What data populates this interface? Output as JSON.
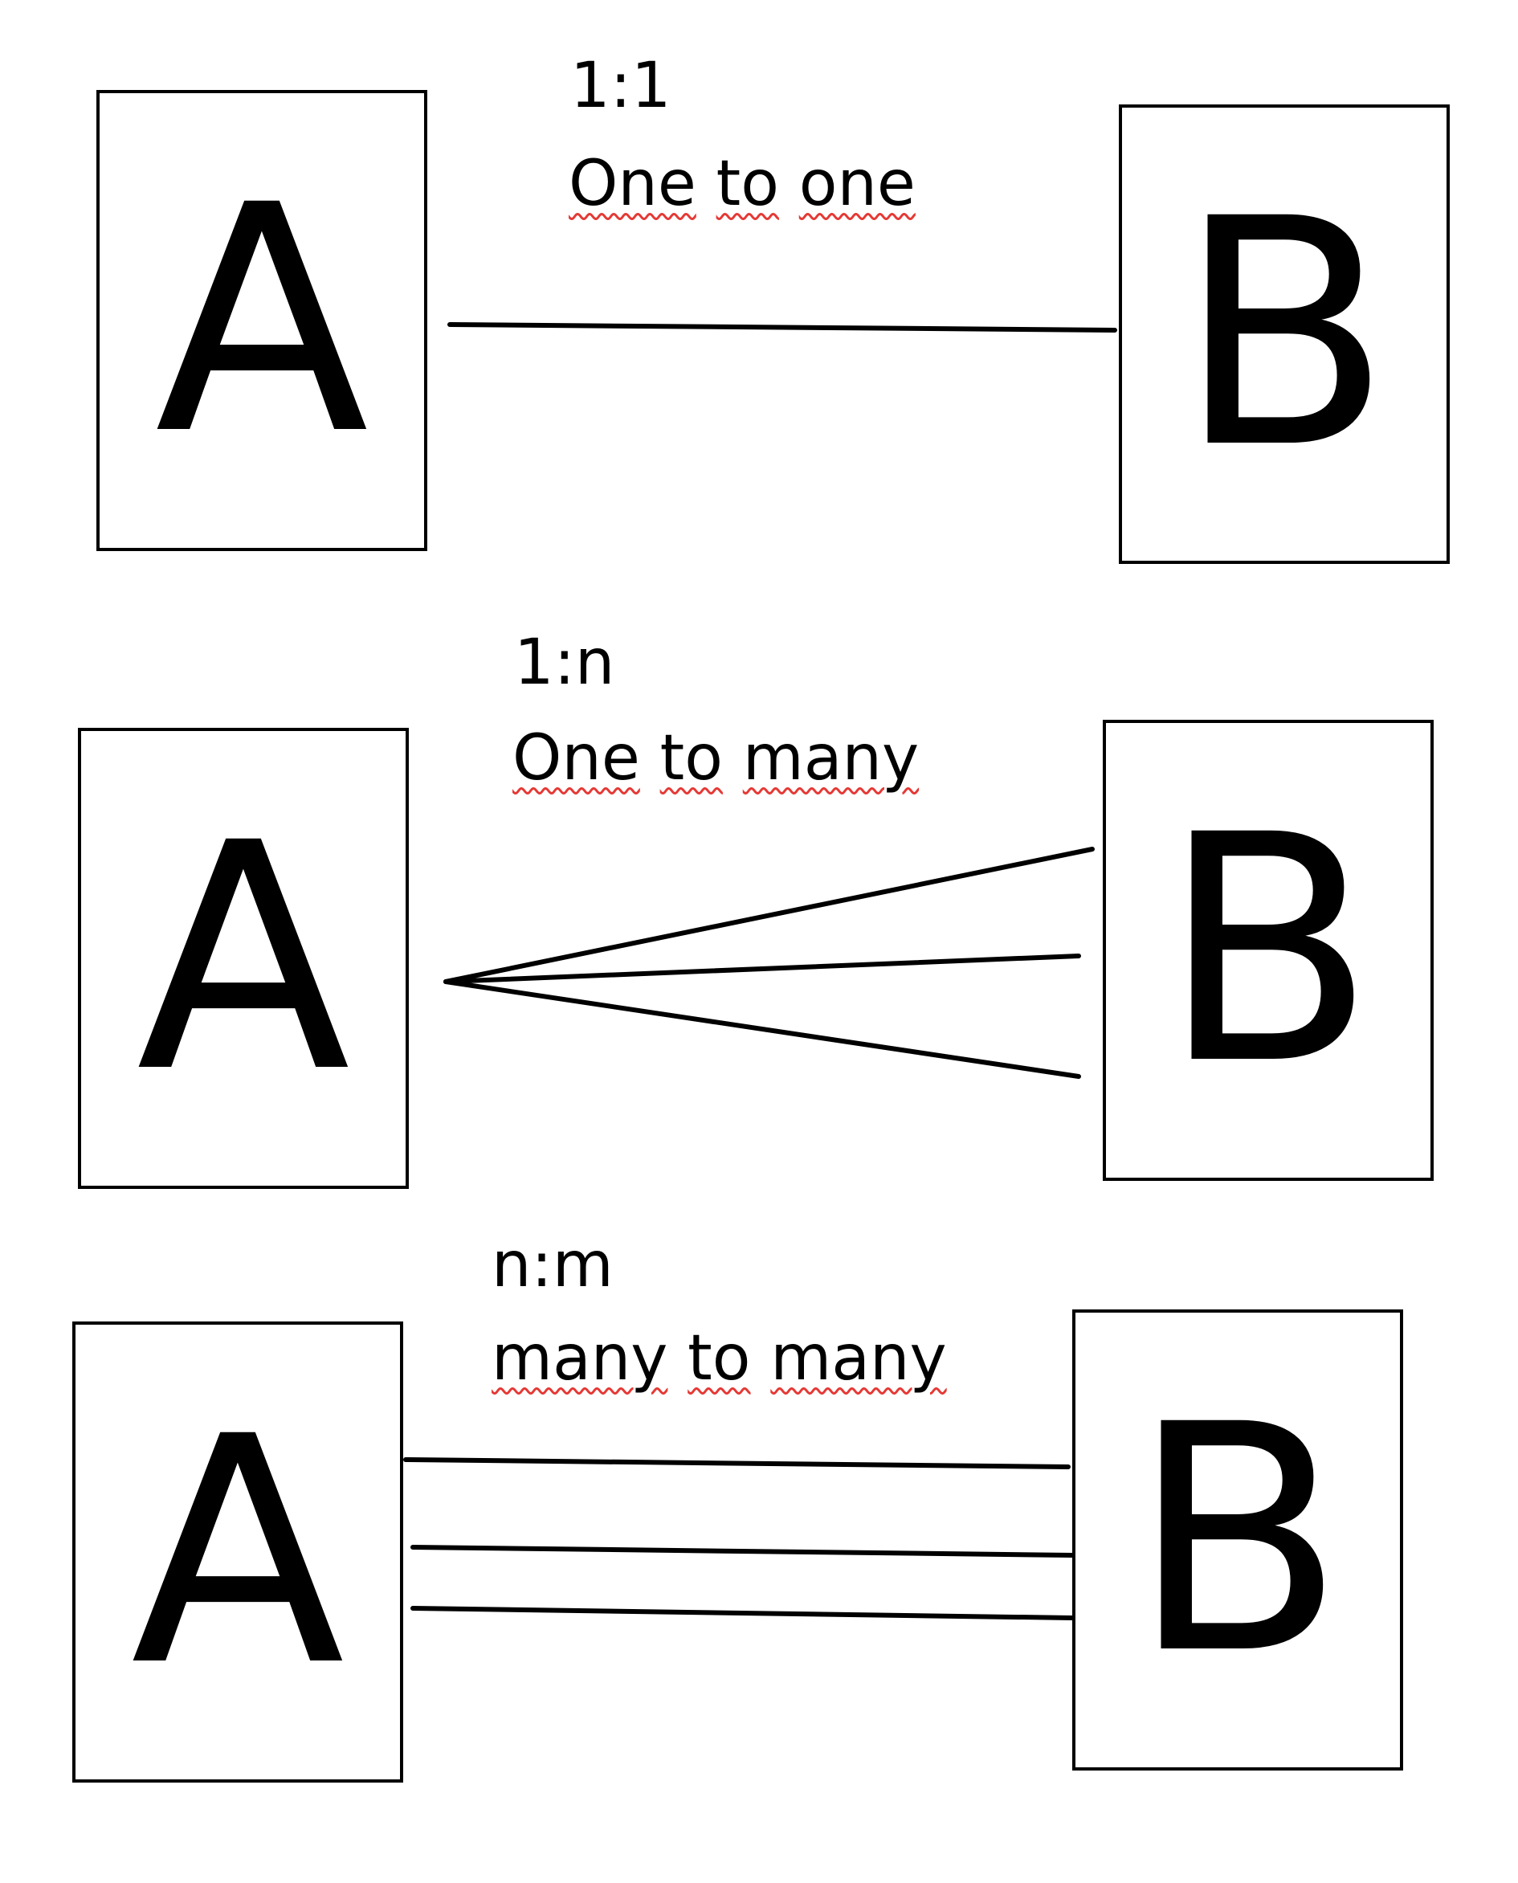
{
  "rows": [
    {
      "ratio": "1:1",
      "caption_words": [
        "One",
        "to",
        "one"
      ],
      "left_entity": "A",
      "right_entity": "B"
    },
    {
      "ratio": "1:n",
      "caption_words": [
        "One",
        "to",
        "many"
      ],
      "left_entity": "A",
      "right_entity": "B"
    },
    {
      "ratio": "n:m",
      "caption_words": [
        "many",
        "to",
        "many"
      ],
      "left_entity": "A",
      "right_entity": "B"
    }
  ],
  "colors": {
    "stroke": "#000000",
    "spellcheck_underline": "#e53935",
    "background": "#ffffff"
  }
}
